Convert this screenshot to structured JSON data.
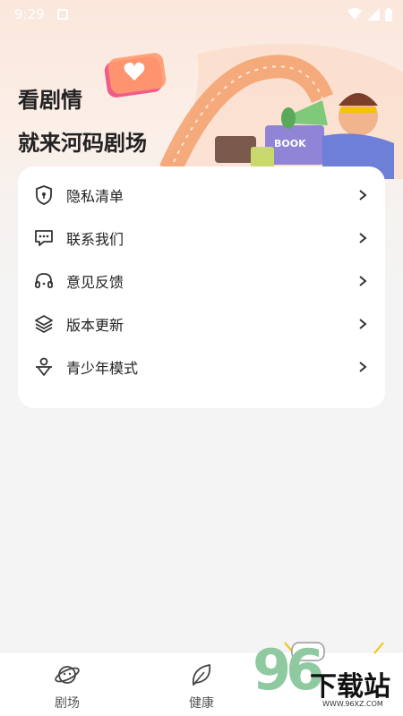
{
  "status_bar": {
    "time": "9:29"
  },
  "hero": {
    "line1": "看剧情",
    "line2": "就来河码剧场",
    "book_text": "BOOK"
  },
  "menu": {
    "items": [
      {
        "label": "隐私清单",
        "icon": "shield-lock-icon"
      },
      {
        "label": "联系我们",
        "icon": "chat-dots-icon"
      },
      {
        "label": "意见反馈",
        "icon": "headset-icon"
      },
      {
        "label": "版本更新",
        "icon": "layers-icon"
      },
      {
        "label": "青少年模式",
        "icon": "youth-person-icon"
      }
    ]
  },
  "tabs": [
    {
      "label": "剧场",
      "icon": "planet-icon"
    },
    {
      "label": "健康",
      "icon": "leaf-icon"
    }
  ],
  "watermark": {
    "number": "96",
    "text": "下载站",
    "url": "WWW.96XZ.COM"
  },
  "colors": {
    "accent": "#f26a3d",
    "icon": "#333333",
    "bg": "#f4f4f4"
  }
}
